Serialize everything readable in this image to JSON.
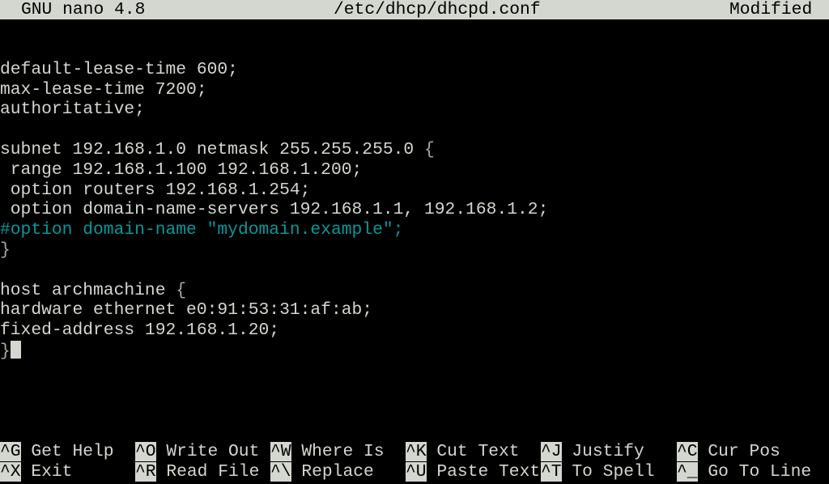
{
  "titlebar": {
    "app": "GNU nano 4.8",
    "filename": "/etc/dhcp/dhcpd.conf",
    "status": "Modified"
  },
  "editor": {
    "lines": [
      {
        "text": "",
        "type": "normal"
      },
      {
        "text": "default-lease-time 600;",
        "type": "normal"
      },
      {
        "text": "max-lease-time 7200;",
        "type": "normal"
      },
      {
        "text": "authoritative;",
        "type": "normal"
      },
      {
        "text": "",
        "type": "normal"
      },
      {
        "text": "subnet 192.168.1.0 netmask 255.255.255.0 ",
        "brace": "{",
        "type": "normal"
      },
      {
        "text": " range 192.168.1.100 192.168.1.200;",
        "type": "normal"
      },
      {
        "text": " option routers 192.168.1.254;",
        "type": "normal"
      },
      {
        "text": " option domain-name-servers 192.168.1.1, 192.168.1.2;",
        "type": "normal"
      },
      {
        "text": "#option domain-name \"mydomain.example\";",
        "type": "comment"
      },
      {
        "text": "",
        "brace": "}",
        "type": "normal"
      },
      {
        "text": "",
        "type": "normal"
      },
      {
        "text": "host archmachine ",
        "brace": "{",
        "type": "normal"
      },
      {
        "text": "hardware ethernet e0:91:53:31:af:ab;",
        "type": "normal"
      },
      {
        "text": "fixed-address 192.168.1.20;",
        "type": "normal"
      },
      {
        "text": "",
        "brace": "}",
        "type": "normal",
        "cursor": true
      }
    ]
  },
  "shortcuts": {
    "row1": [
      {
        "key": "^G",
        "label": "Get Help"
      },
      {
        "key": "^O",
        "label": "Write Out"
      },
      {
        "key": "^W",
        "label": "Where Is"
      },
      {
        "key": "^K",
        "label": "Cut Text"
      },
      {
        "key": "^J",
        "label": "Justify"
      },
      {
        "key": "^C",
        "label": "Cur Pos"
      }
    ],
    "row2": [
      {
        "key": "^X",
        "label": "Exit"
      },
      {
        "key": "^R",
        "label": "Read File"
      },
      {
        "key": "^\\",
        "label": "Replace"
      },
      {
        "key": "^U",
        "label": "Paste Text"
      },
      {
        "key": "^T",
        "label": "To Spell"
      },
      {
        "key": "^_",
        "label": "Go To Line"
      }
    ]
  }
}
